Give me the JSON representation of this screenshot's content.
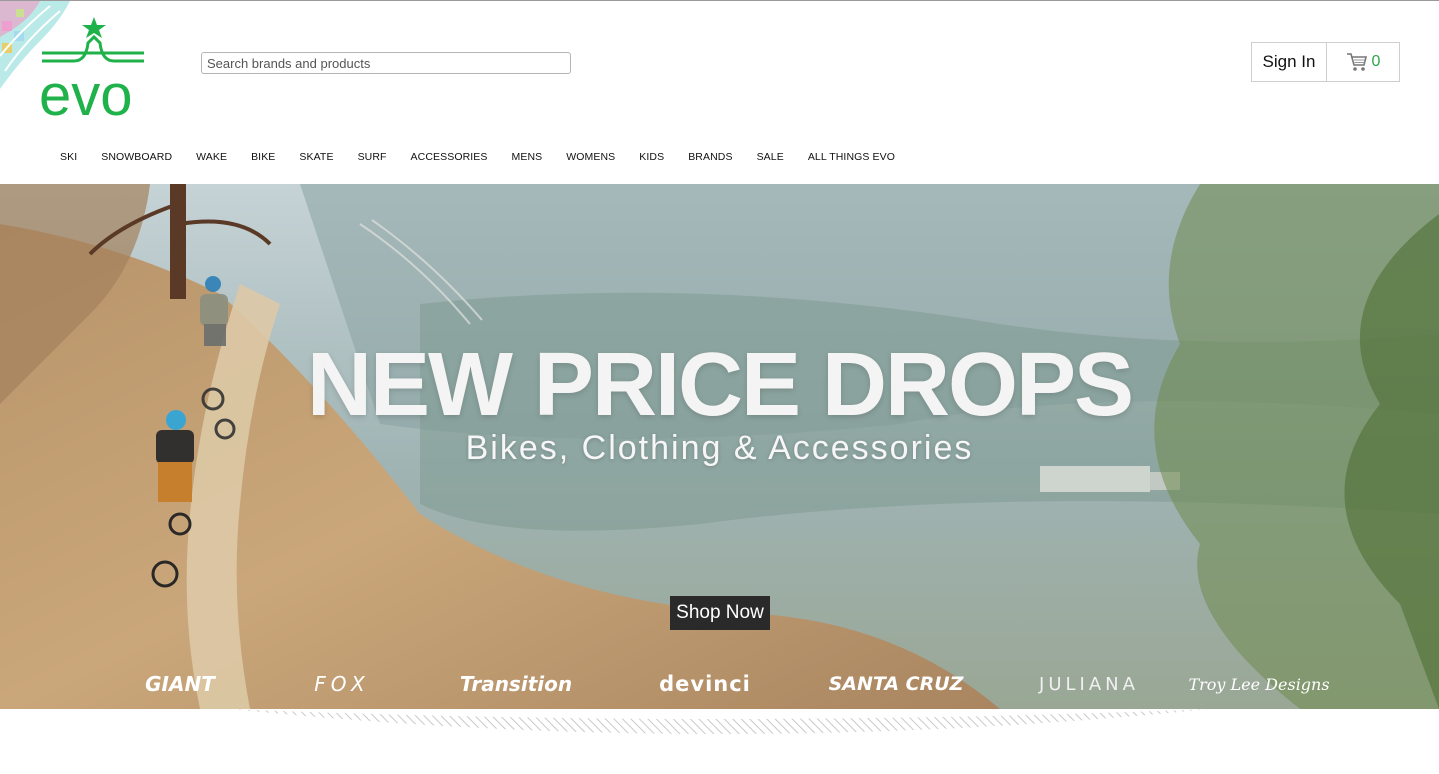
{
  "header": {
    "logo_text": "evo",
    "search": {
      "placeholder": "Search brands and products",
      "value": ""
    },
    "sign_in_label": "Sign In",
    "cart": {
      "icon": "cart-icon",
      "count": "0"
    },
    "colors": {
      "brand_green": "#1fb24a",
      "cart_count": "#2aa84a"
    }
  },
  "nav": {
    "items": [
      "SKI",
      "SNOWBOARD",
      "WAKE",
      "BIKE",
      "SKATE",
      "SURF",
      "ACCESSORIES",
      "MENS",
      "WOMENS",
      "KIDS",
      "BRANDS",
      "SALE",
      "ALL THINGS EVO"
    ]
  },
  "hero": {
    "headline": "NEW PRICE DROPS",
    "subheadline": "Bikes, Clothing & Accessories",
    "cta_label": "Shop Now",
    "brands": [
      "GIANT",
      "FOX",
      "Transition",
      "devinci",
      "SANTA CRUZ",
      "JULIANA",
      "Troy Lee Designs"
    ]
  }
}
